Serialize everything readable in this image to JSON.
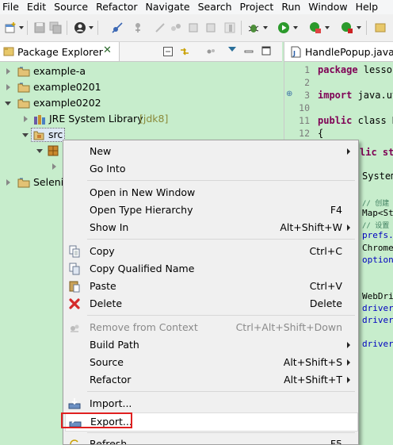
{
  "menubar": {
    "items": [
      "File",
      "Edit",
      "Source",
      "Refactor",
      "Navigate",
      "Search",
      "Project",
      "Run",
      "Window",
      "Help"
    ]
  },
  "toolbar": {
    "icons": [
      "new-wizard-icon",
      "save-icon",
      "save-all-icon",
      "profile-icon",
      "skip-breakpoints-icon",
      "debug-icon",
      "run-icon",
      "external-tools-icon",
      "coverage-icon"
    ]
  },
  "package_explorer": {
    "tab_label": "Package Explorer",
    "tree": [
      {
        "label": "example-a",
        "expanded": false
      },
      {
        "label": "example0201",
        "expanded": false
      },
      {
        "label": "example0202",
        "expanded": true
      },
      {
        "label": "JRE System Library",
        "decoration": "[jdk8]"
      },
      {
        "label": "src",
        "selected": true
      },
      {
        "label": "Seleni"
      }
    ]
  },
  "editor": {
    "tab_label": "HandlePopup.java",
    "line_numbers": [
      "1",
      "2",
      "3",
      "10",
      "11",
      "12"
    ],
    "lines": [
      {
        "kw": "package",
        "text": " lesson"
      },
      {
        "kw": "",
        "text": ""
      },
      {
        "kw": "import",
        "text": " java.ut"
      },
      {
        "kw": "",
        "text": ""
      },
      {
        "kw": "public",
        "text": " class H"
      },
      {
        "kw": "",
        "text": "{"
      }
    ],
    "hidden_lines": {
      "a": "lic sta",
      "b": "System",
      "c1": "// 创建",
      "c2": "Map<St",
      "c3": "// 设置",
      "c4": "prefs.",
      "c5": "Chrome",
      "c6": "option",
      "d1": "WebDri",
      "d2": "driver",
      "d3": "driver",
      "d4": "driver"
    }
  },
  "context_menu": {
    "items": [
      {
        "label": "New",
        "shortcut": "",
        "submenu": true
      },
      {
        "label": "Go Into",
        "shortcut": "",
        "submenu": false
      },
      {
        "label": "Open in New Window",
        "shortcut": "",
        "submenu": false
      },
      {
        "label": "Open Type Hierarchy",
        "shortcut": "F4",
        "submenu": false
      },
      {
        "label": "Show In",
        "shortcut": "Alt+Shift+W",
        "submenu": true
      },
      {
        "label": "Copy",
        "shortcut": "Ctrl+C",
        "icon": "copy-icon"
      },
      {
        "label": "Copy Qualified Name",
        "shortcut": "",
        "icon": "copy-qualified-icon"
      },
      {
        "label": "Paste",
        "shortcut": "Ctrl+V",
        "icon": "paste-icon"
      },
      {
        "label": "Delete",
        "shortcut": "Delete",
        "icon": "delete-icon"
      },
      {
        "label": "Remove from Context",
        "shortcut": "Ctrl+Alt+Shift+Down",
        "icon": "remove-context-icon",
        "disabled": true
      },
      {
        "label": "Build Path",
        "shortcut": "",
        "submenu": true
      },
      {
        "label": "Source",
        "shortcut": "Alt+Shift+S",
        "submenu": true
      },
      {
        "label": "Refactor",
        "shortcut": "Alt+Shift+T",
        "submenu": true
      },
      {
        "label": "Import...",
        "shortcut": "",
        "icon": "import-icon"
      },
      {
        "label": "Export...",
        "shortcut": "",
        "icon": "export-icon",
        "highlighted": true
      },
      {
        "label": "Refresh",
        "shortcut": "F5",
        "icon": "refresh-icon"
      }
    ]
  },
  "colors": {
    "background": "#c7edcc",
    "highlight_border": "#e02020",
    "keyword": "#7f0055",
    "comment": "#3f7f5f"
  }
}
